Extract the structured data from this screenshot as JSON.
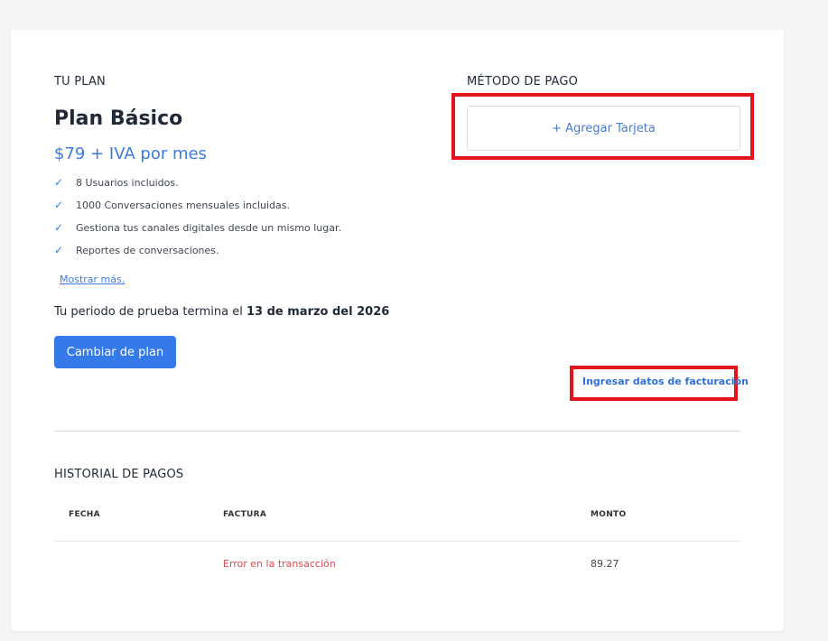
{
  "plan_section": {
    "title": "TU PLAN",
    "plan_name": "Plan Básico",
    "price": "$79 + IVA por mes",
    "features": [
      "8 Usuarios incluidos.",
      "1000 Conversaciones mensuales incluidas.",
      "Gestiona tus canales digitales desde un mismo lugar.",
      "Reportes de conversaciones."
    ],
    "check_glyph": "✓",
    "show_more": "Mostrar más.",
    "trial_prefix": "Tu periodo de prueba termina el",
    "trial_date": "13 de marzo del 2026",
    "change_plan_button": "Cambiar de plan"
  },
  "payment_section": {
    "title": "MÉTODO DE PAGO",
    "add_card_button": "+ Agregar Tarjeta",
    "billing_link": "Ingresar datos de facturación"
  },
  "history_section": {
    "title": "HISTORIAL DE PAGOS",
    "columns": [
      "FECHA",
      "FACTURA",
      "MONTO"
    ],
    "rows": [
      {
        "fecha": "",
        "factura": "Error en la transacción",
        "monto": "89.27"
      }
    ]
  },
  "colors": {
    "accent": "#3679e8",
    "highlight": "#e3141a",
    "error": "#e0484d"
  }
}
